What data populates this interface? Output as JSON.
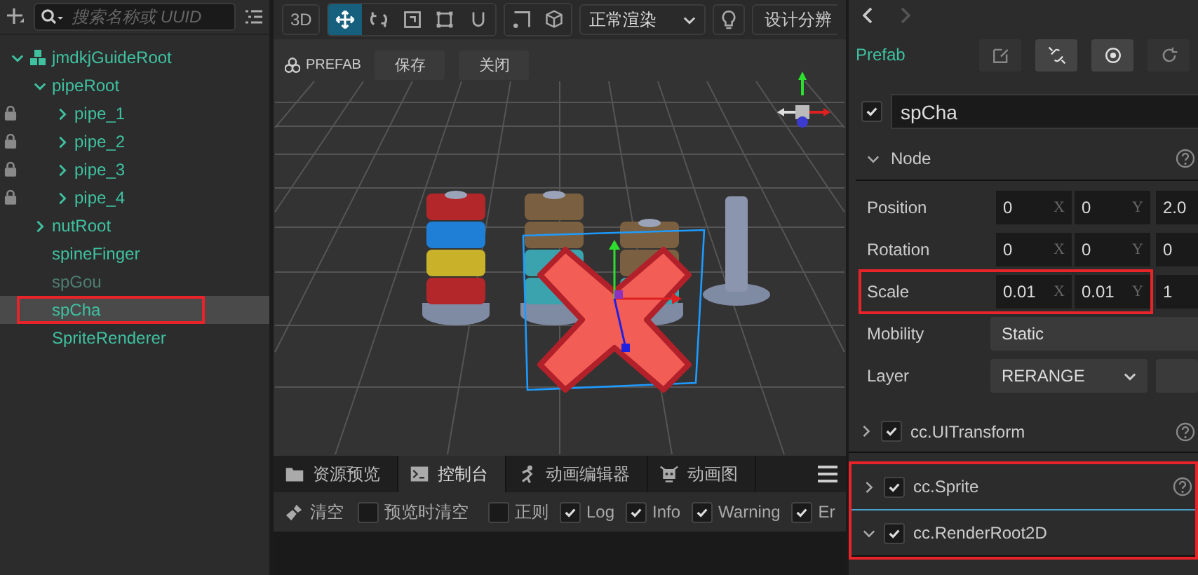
{
  "hierarchy": {
    "search": {
      "placeholder": "搜索名称或 UUID"
    },
    "tree": [
      {
        "name": "jmdkjGuideRoot",
        "kind": "prefab",
        "expanded": true,
        "selected": false,
        "children": [
          {
            "name": "pipeRoot",
            "expanded": true,
            "selected": false,
            "children": [
              {
                "name": "pipe_1",
                "locked": true,
                "expanded": false,
                "selected": false
              },
              {
                "name": "pipe_2",
                "locked": true,
                "expanded": false,
                "selected": false
              },
              {
                "name": "pipe_3",
                "locked": true,
                "expanded": false,
                "selected": false
              },
              {
                "name": "pipe_4",
                "locked": true,
                "expanded": false,
                "selected": false
              }
            ]
          },
          {
            "name": "nutRoot",
            "expanded": false,
            "selected": false
          },
          {
            "name": "spineFinger",
            "selected": false
          },
          {
            "name": "spGou",
            "active": false,
            "selected": false
          },
          {
            "name": "spCha",
            "selected": true,
            "highlighted": true
          },
          {
            "name": "SpriteRenderer",
            "selected": false
          }
        ]
      }
    ]
  },
  "scene": {
    "toolbar": {
      "mode": "3D",
      "tools": [
        {
          "kind": "move",
          "selected": true
        },
        {
          "kind": "rotate",
          "selected": false
        },
        {
          "kind": "scale",
          "selected": false
        },
        {
          "kind": "rect",
          "selected": false
        },
        {
          "kind": "snap",
          "selected": false
        }
      ],
      "render_mode": "正常渲染",
      "resolution": "设计分辨"
    },
    "prefab_bar": {
      "label": "PREFAB",
      "buttons": [
        "保存",
        "关闭"
      ]
    }
  },
  "bottom_panel": {
    "tabs": [
      {
        "label": "资源预览",
        "kind": "assets",
        "selected": false
      },
      {
        "label": "控制台",
        "kind": "console",
        "selected": true
      },
      {
        "label": "动画编辑器",
        "kind": "animation",
        "selected": false
      },
      {
        "label": "动画图",
        "kind": "graph",
        "selected": false
      }
    ],
    "clear": "清空",
    "filters": [
      {
        "kind": "checkbox",
        "label": "预览时清空",
        "checked": false
      },
      {
        "kind": "separator"
      },
      {
        "label": "正则",
        "checked": false
      },
      {
        "label": "Log",
        "checked": true
      },
      {
        "label": "Info",
        "checked": true
      },
      {
        "label": "Warning",
        "checked": true
      },
      {
        "label": "Er",
        "checked": true
      }
    ]
  },
  "inspector": {
    "title": "Prefab",
    "node_name": "spCha",
    "node_active": true,
    "section": {
      "title": "Node",
      "expanded": true
    },
    "vectors": [
      {
        "label": "Position",
        "values": [
          "0",
          "0",
          "2.0"
        ],
        "axes": [
          "X",
          "Y"
        ],
        "highlighted": false
      },
      {
        "label": "Rotation",
        "values": [
          "0",
          "0",
          "0"
        ],
        "axes": [
          "X",
          "Y"
        ],
        "highlighted": false
      },
      {
        "label": "Scale",
        "values": [
          "0.01",
          "0.01",
          "1"
        ],
        "axes": [
          "X",
          "Y"
        ],
        "highlighted": true
      }
    ],
    "mobility": {
      "label": "Mobility",
      "value": "Static"
    },
    "layer": {
      "label": "Layer",
      "value": "RERANGE"
    },
    "components": [
      {
        "name": "cc.UITransform",
        "enabled": true,
        "expanded": false,
        "highlighted": false
      },
      {
        "name": "cc.Sprite",
        "enabled": true,
        "expanded": false,
        "highlighted": true
      },
      {
        "name": "cc.RenderRoot2D",
        "enabled": true,
        "expanded": true,
        "highlighted": true
      }
    ]
  }
}
